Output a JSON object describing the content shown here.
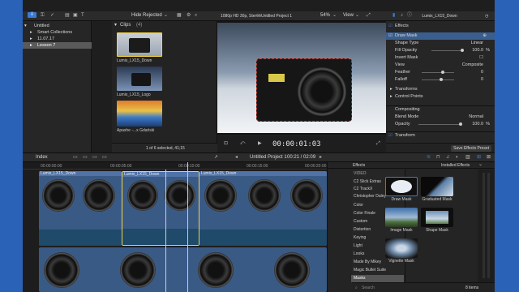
{
  "window": {
    "project_title": "Untitled Project 1",
    "format": "1080p HD 30p, Stereo",
    "zoom": "54%",
    "view_label": "View"
  },
  "toolbar": {
    "filter": "Hide Rejected"
  },
  "libraries": {
    "items": [
      {
        "label": "Untitled"
      },
      {
        "label": "Smart Collections"
      },
      {
        "label": "11.07.17"
      },
      {
        "label": "Lesson 7"
      }
    ]
  },
  "browser": {
    "title": "Clips",
    "count": "(4)",
    "clips": [
      {
        "label": "Lumix_LX15_Down"
      },
      {
        "label": "Lumix_LX15_Logo"
      },
      {
        "label": "Apashe -...x Gdański"
      }
    ],
    "status": "1 of 6 selected, 41;15"
  },
  "viewer": {
    "timecode": "00:00:01:03"
  },
  "inspector": {
    "clip_name": "Lumix_LX15_Down",
    "effects_header": "Effects",
    "draw_mask": "Draw Mask",
    "rows": [
      {
        "label": "Shape Type",
        "value": "Linear"
      },
      {
        "label": "Fill Opacity",
        "value": "100.0"
      },
      {
        "label": "Invert Mask",
        "value": ""
      },
      {
        "label": "View",
        "value": "Composite"
      },
      {
        "label": "Feather",
        "value": "0"
      },
      {
        "label": "Falloff",
        "value": "0"
      }
    ],
    "sections": [
      "Transforms",
      "Control Points"
    ],
    "compositing": "Compositing",
    "blend_label": "Blend Mode",
    "blend_value": "Normal",
    "opacity_label": "Opacity",
    "opacity_value": "100.0",
    "transform": "Transform",
    "save_preset": "Save Effects Preset",
    "percent": "%"
  },
  "timeline": {
    "index": "Index",
    "project": "Untitled Project 1",
    "time": "00:21 / 02:09",
    "ruler": [
      "00:00:00:00",
      "00:00:05:00",
      "00:00:10:00",
      "00:00:15:00",
      "00:00:20:00"
    ],
    "clips": [
      {
        "label": "Lumix_LX15_Down"
      },
      {
        "label": "Lumix_LX15_Down"
      },
      {
        "label": "Lumix_LX15_Down"
      }
    ]
  },
  "effects": {
    "header": "Effects",
    "installed": "Installed Effects",
    "categories": [
      "VIDEO",
      "C2 Slick Extras",
      "C2 TrackX",
      "Christopher Daley",
      "Color",
      "Color Finale",
      "Custom",
      "Distortion",
      "Keying",
      "Light",
      "Looks",
      "Made By Mikey",
      "Magic Bullet Suite",
      "Masks"
    ],
    "items": [
      {
        "label": "Draw Mask"
      },
      {
        "label": "Graduated Mask"
      },
      {
        "label": "Image Mask"
      },
      {
        "label": "Shape Mask"
      },
      {
        "label": "Vignette Mask"
      }
    ],
    "count": "8 items",
    "search_placeholder": "Search"
  },
  "colors": {
    "accent": "#3a7bd5",
    "selection": "#f2d24a",
    "clip_blue": "#3a5a86"
  }
}
